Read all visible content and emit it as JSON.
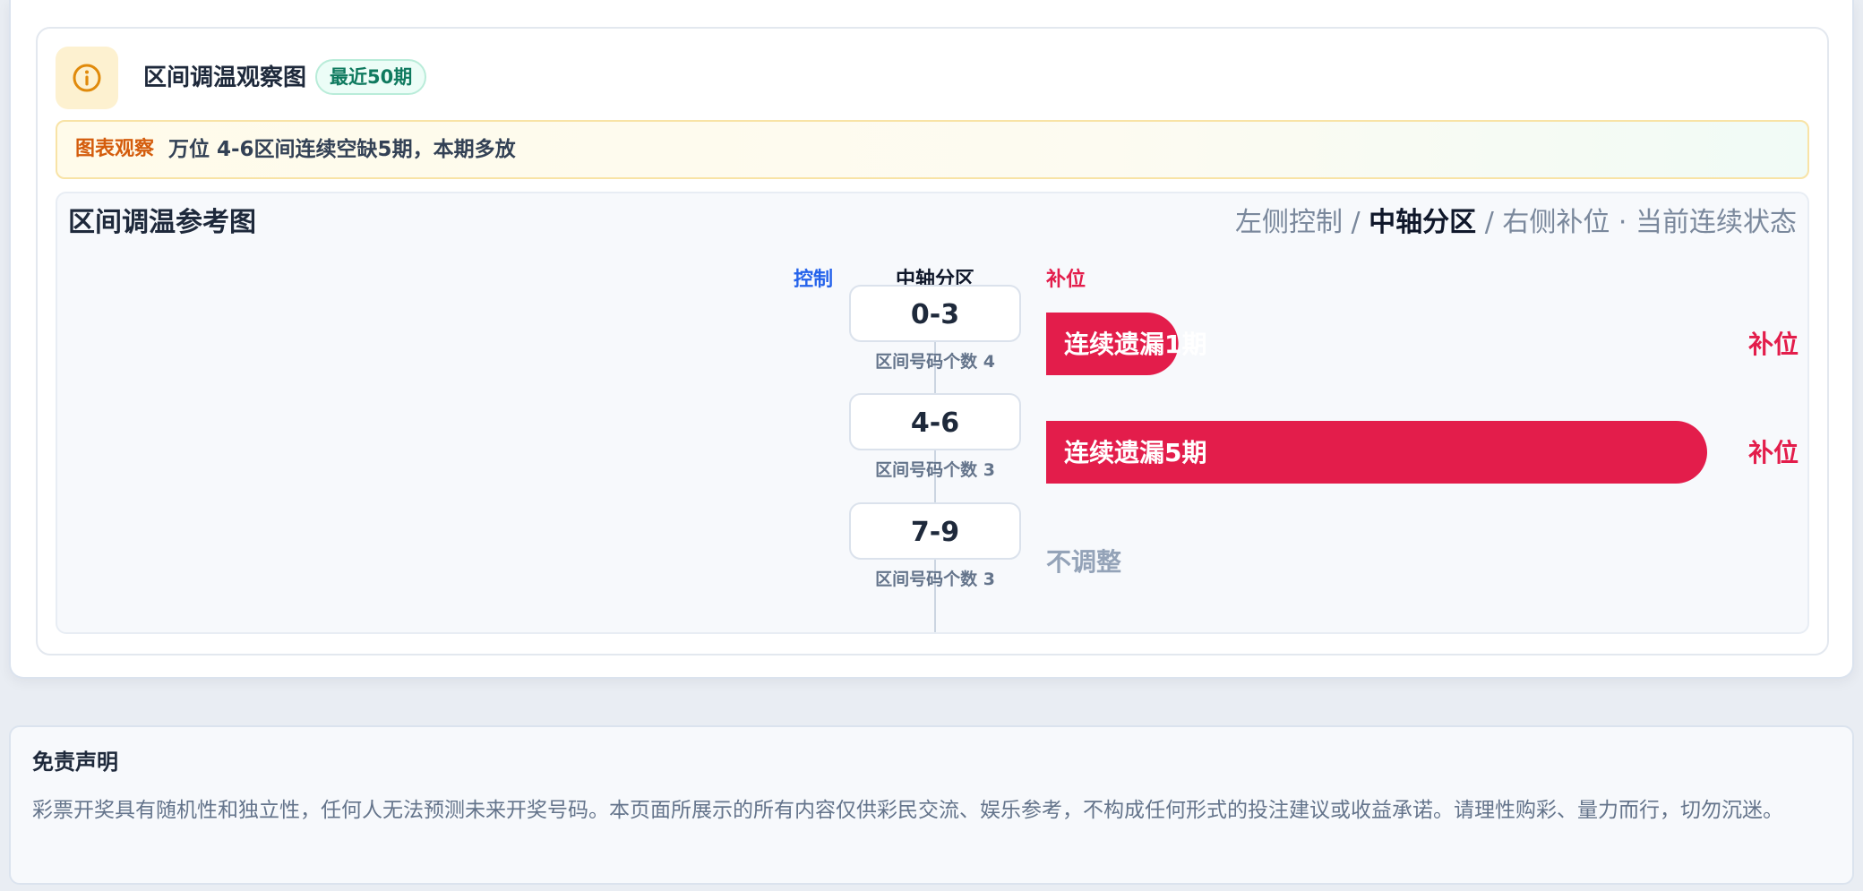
{
  "header": {
    "title": "区间调温观察图",
    "badge": "最近50期",
    "icon": "info-icon"
  },
  "observation": {
    "label": "图表观察",
    "text": "万位 4-6区间连续空缺5期，本期多放"
  },
  "chart_panel": {
    "title": "区间调温参考图",
    "legend": {
      "left": "左侧控制",
      "sep1": "/",
      "center": "中轴分区",
      "sep2": "/",
      "right": "右侧补位",
      "dot": "·",
      "state": "当前连续状态"
    }
  },
  "chart_data": {
    "type": "bar",
    "column_headers": {
      "control": "控制",
      "center": "中轴分区",
      "fill": "补位"
    },
    "categories": [
      "0-3",
      "4-6",
      "7-9"
    ],
    "counts_label": [
      "区间号码个数 4",
      "区间号码个数 3",
      "区间号码个数 3"
    ],
    "values": [
      1,
      5,
      0
    ],
    "bar_labels": [
      "连续遗漏1期",
      "连续遗漏5期",
      ""
    ],
    "status": [
      "补位",
      "补位",
      "不调整"
    ],
    "colors": {
      "fill": "#e31d4b",
      "control": "#2563eb",
      "neutral": "#94a3b8",
      "center": "#0f172a"
    }
  },
  "disclaimer": {
    "title": "免责声明",
    "text": "彩票开奖具有随机性和独立性，任何人无法预测未来开奖号码。本页面所展示的所有内容仅供彩民交流、娱乐参考，不构成任何形式的投注建议或收益承诺。请理性购彩、量力而行，切勿沉迷。"
  }
}
